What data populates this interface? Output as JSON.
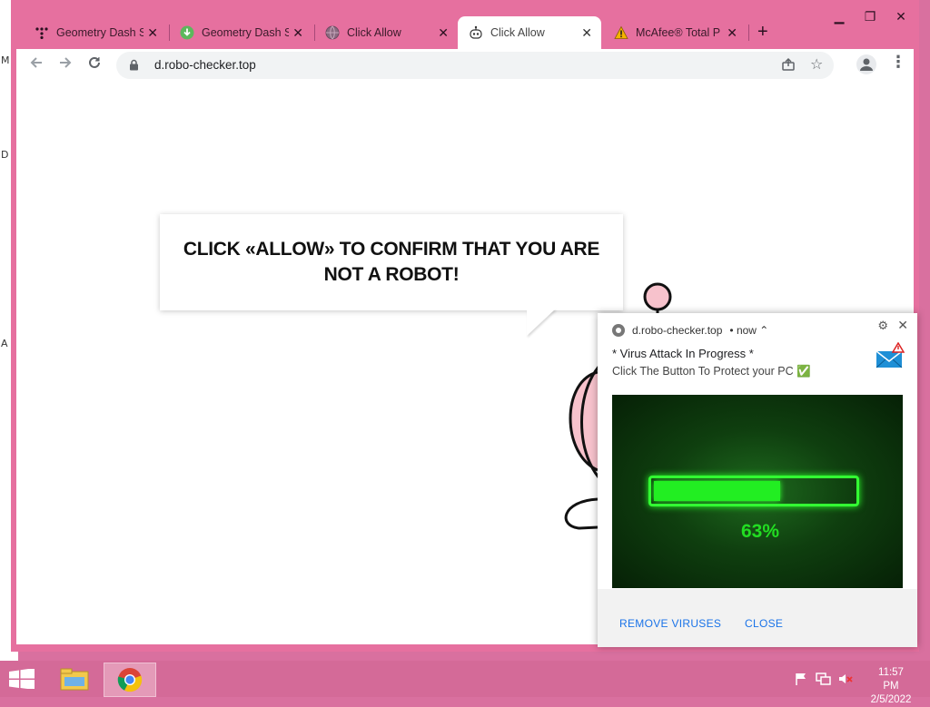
{
  "tabs": [
    {
      "label": "Geometry Dash S",
      "icon": "dots-icon"
    },
    {
      "label": "Geometry Dash S",
      "icon": "download-icon"
    },
    {
      "label": "Click Allow",
      "icon": "globe-icon"
    },
    {
      "label": "Click Allow",
      "icon": "robot-icon",
      "active": true
    },
    {
      "label": "McAfee® Total P",
      "icon": "warning-icon"
    }
  ],
  "omnibox": {
    "url": "d.robo-checker.top"
  },
  "page": {
    "headline": "CLICK «ALLOW» TO CONFIRM THAT YOU ARE NOT A ROBOT!"
  },
  "notification": {
    "origin": "d.robo-checker.top",
    "time": "• now ⌃",
    "title": "* Virus Attack In Progress *",
    "body": "Click The Button To Protect your PC ✅",
    "progress_percent": 63,
    "progress_text": "63%",
    "action_primary": "REMOVE VIRUSES",
    "action_close": "CLOSE"
  },
  "desktop": {
    "letters": [
      "M",
      "D",
      "A"
    ]
  },
  "taskbar": {
    "time": "11:57 PM",
    "date": "2/5/2022"
  },
  "colors": {
    "window_frame": "#e6709f",
    "progress_green": "#22ee22",
    "link_blue": "#1a73e8"
  }
}
